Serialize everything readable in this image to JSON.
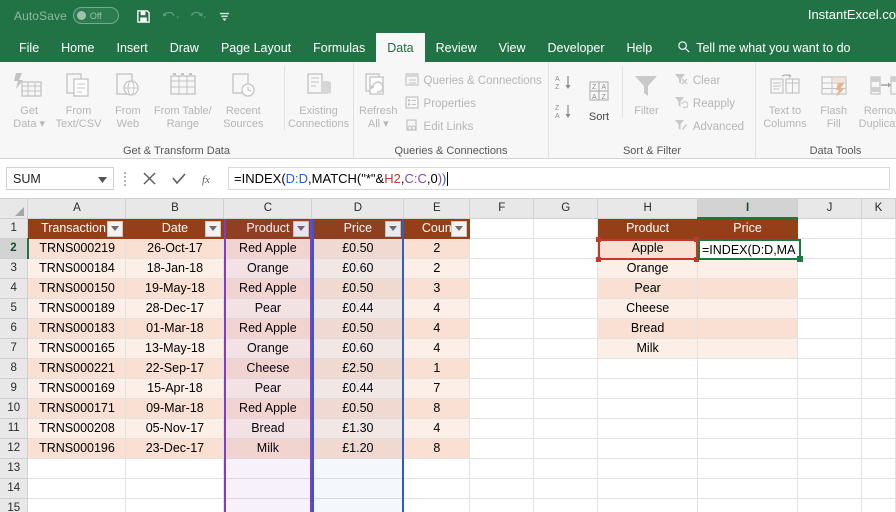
{
  "titlebar": {
    "autosave_label": "AutoSave",
    "autosave_state": "Off",
    "brand": "InstantExcel.co",
    "qat": [
      "save-icon",
      "undo-icon",
      "redo-icon",
      "customize-quick-access-icon"
    ]
  },
  "ribbon": {
    "tabs": [
      {
        "label": "File",
        "active": false
      },
      {
        "label": "Home",
        "active": false
      },
      {
        "label": "Insert",
        "active": false
      },
      {
        "label": "Draw",
        "active": false
      },
      {
        "label": "Page Layout",
        "active": false
      },
      {
        "label": "Formulas",
        "active": false
      },
      {
        "label": "Data",
        "active": true
      },
      {
        "label": "Review",
        "active": false
      },
      {
        "label": "View",
        "active": false
      },
      {
        "label": "Developer",
        "active": false
      },
      {
        "label": "Help",
        "active": false
      }
    ],
    "tellme": "Tell me what you want to do",
    "groups": [
      {
        "title": "Get & Transform Data",
        "big_buttons": [
          {
            "label": "Get\nData ▾",
            "icon": "get-data-icon"
          },
          {
            "label": "From\nText/CSV",
            "icon": "from-text-csv-icon"
          },
          {
            "label": "From\nWeb",
            "icon": "from-web-icon"
          },
          {
            "label": "From Table/\nRange",
            "icon": "from-table-range-icon"
          },
          {
            "label": "Recent\nSources",
            "icon": "recent-sources-icon"
          },
          {
            "label": "Existing\nConnections",
            "icon": "existing-connections-icon"
          }
        ]
      },
      {
        "title": "Queries & Connections",
        "big_buttons": [
          {
            "label": "Refresh\nAll ▾",
            "icon": "refresh-all-icon"
          }
        ],
        "small_buttons": [
          {
            "label": "Queries & Connections",
            "icon": "queries-connections-icon"
          },
          {
            "label": "Properties",
            "icon": "properties-icon"
          },
          {
            "label": "Edit Links",
            "icon": "edit-links-icon"
          }
        ]
      },
      {
        "title": "Sort & Filter",
        "sort_labels": {
          "az": "A-Z",
          "za": "Z-A",
          "sort": "Sort"
        },
        "big_buttons": [
          {
            "label": "Filter",
            "icon": "filter-icon"
          }
        ],
        "small_buttons": [
          {
            "label": "Clear",
            "icon": "clear-filter-icon"
          },
          {
            "label": "Reapply",
            "icon": "reapply-filter-icon"
          },
          {
            "label": "Advanced",
            "icon": "advanced-filter-icon"
          }
        ]
      },
      {
        "title": "Data Tools",
        "big_buttons": [
          {
            "label": "Text to\nColumns",
            "icon": "text-to-columns-icon"
          },
          {
            "label": "Flash\nFill",
            "icon": "flash-fill-icon"
          },
          {
            "label": "Remove\nDuplicates",
            "icon": "remove-duplicates-icon"
          }
        ]
      }
    ]
  },
  "formula_bar": {
    "name_box": "SUM",
    "cancel_icon": "cancel-icon",
    "enter_icon": "confirm-icon",
    "function_icon": "insert-function-icon",
    "formula_full": "=INDEX(D:D,MATCH(\"*\"&H2,C:C,0))",
    "formula_parts": [
      {
        "text": "=INDEX(",
        "color": "black"
      },
      {
        "text": "D:D",
        "color": "blue"
      },
      {
        "text": ",MATCH(\"*\"&",
        "color": "black"
      },
      {
        "text": "H2",
        "color": "red"
      },
      {
        "text": ",",
        "color": "black"
      },
      {
        "text": "C:C",
        "color": "purple"
      },
      {
        "text": ",0",
        "color": "black"
      },
      {
        "text": ")",
        "color": "purple"
      },
      {
        "text": ")",
        "color": "blue"
      }
    ]
  },
  "grid": {
    "column_letters": [
      "A",
      "B",
      "C",
      "D",
      "E",
      "F",
      "G",
      "H",
      "I",
      "J",
      "K"
    ],
    "selected_column": "I",
    "row_numbers": [
      "1",
      "2",
      "3",
      "4",
      "5",
      "6",
      "7",
      "8",
      "9",
      "10",
      "11",
      "12",
      "13",
      "14",
      "15"
    ],
    "selected_row": "2",
    "table1": {
      "headers": [
        "Transaction I",
        "Date",
        "Product",
        "Price",
        "Coun"
      ],
      "rows": [
        [
          "TRNS000219",
          "26-Oct-17",
          "Red Apple",
          "£0.50",
          "2"
        ],
        [
          "TRNS000184",
          "18-Jan-18",
          "Orange",
          "£0.60",
          "2"
        ],
        [
          "TRNS000150",
          "19-May-18",
          "Red Apple",
          "£0.50",
          "3"
        ],
        [
          "TRNS000189",
          "28-Dec-17",
          "Pear",
          "£0.44",
          "4"
        ],
        [
          "TRNS000183",
          "01-Mar-18",
          "Red Apple",
          "£0.50",
          "4"
        ],
        [
          "TRNS000165",
          "13-May-18",
          "Orange",
          "£0.60",
          "4"
        ],
        [
          "TRNS000221",
          "22-Sep-17",
          "Cheese",
          "£2.50",
          "1"
        ],
        [
          "TRNS000169",
          "15-Apr-18",
          "Pear",
          "£0.44",
          "7"
        ],
        [
          "TRNS000171",
          "09-Mar-18",
          "Red Apple",
          "£0.50",
          "8"
        ],
        [
          "TRNS000208",
          "05-Nov-17",
          "Bread",
          "£1.30",
          "4"
        ],
        [
          "TRNS000196",
          "23-Dec-17",
          "Milk",
          "£1.20",
          "8"
        ]
      ]
    },
    "table2": {
      "headers": [
        "Product",
        "Price"
      ],
      "products": [
        "Apple",
        "Orange",
        "Pear",
        "Cheese",
        "Bread",
        "Milk"
      ],
      "active_cell_text": "=INDEX(D:D,MA"
    }
  },
  "colors": {
    "excel_green": "#217346",
    "table_header_brown": "#943f17",
    "band_dark": "#fae0d2",
    "band_light": "#fcefe7",
    "ref_blue": "#2a5fc9",
    "ref_purple": "#7f3fbf",
    "ref_red": "#c0392b",
    "active_green": "#1a7a42"
  }
}
